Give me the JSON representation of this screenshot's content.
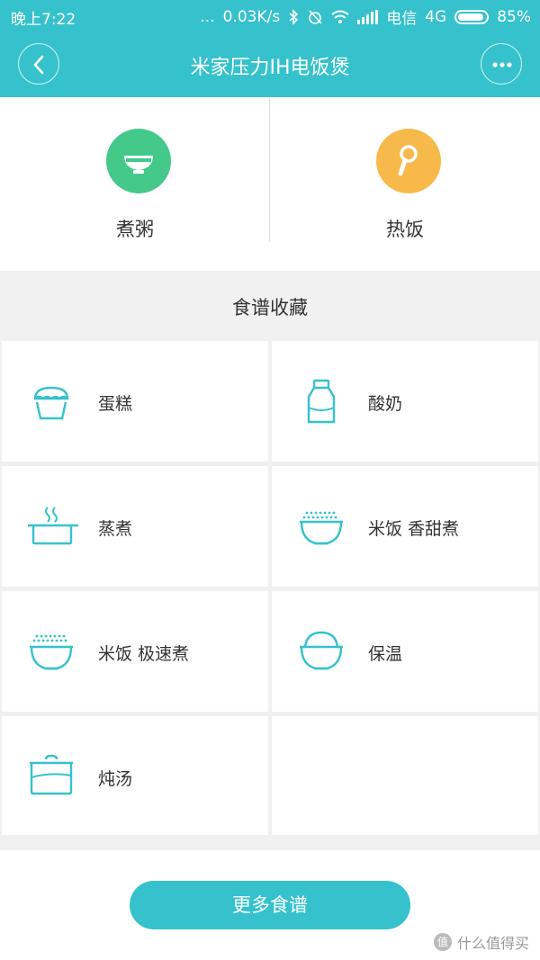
{
  "status_bar": {
    "time": "晚上7:22",
    "dots": "...",
    "network_speed": "0.03K/s",
    "carrier": "电信",
    "network_type": "4G",
    "battery": "85%"
  },
  "header": {
    "title": "米家压力IH电饭煲",
    "back_icon": "chevron-left-icon",
    "more_icon": "more-dots-icon"
  },
  "modes": [
    {
      "label": "煮粥",
      "icon": "bowl-icon",
      "color": "#44c98b"
    },
    {
      "label": "热饭",
      "icon": "spoon-icon",
      "color": "#f7b94a"
    }
  ],
  "recipes_section": {
    "title": "食谱收藏",
    "items": [
      {
        "label": "蛋糕",
        "icon": "cake-icon"
      },
      {
        "label": "酸奶",
        "icon": "yogurt-bottle-icon"
      },
      {
        "label": "蒸煮",
        "icon": "steam-pot-icon"
      },
      {
        "label": "米饭 香甜煮",
        "icon": "rice-bowl-icon"
      },
      {
        "label": "米饭 极速煮",
        "icon": "rice-bowl-icon"
      },
      {
        "label": "保温",
        "icon": "warm-bowl-icon"
      },
      {
        "label": "炖汤",
        "icon": "soup-pot-icon"
      }
    ]
  },
  "footer": {
    "more_button": "更多食谱",
    "watermark": "什么值得买",
    "watermark_badge": "值"
  },
  "colors": {
    "accent": "#35c2cc",
    "icon_line": "#35c2cc"
  }
}
